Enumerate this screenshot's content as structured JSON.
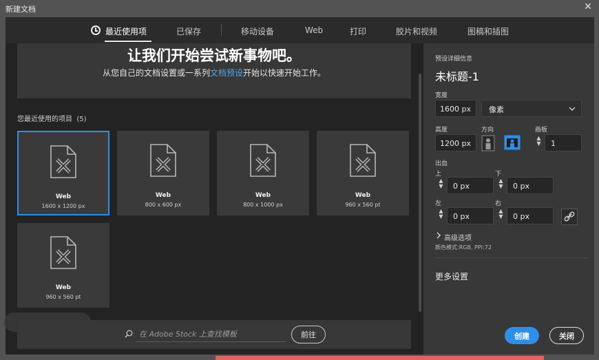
{
  "window": {
    "title": "新建文档",
    "close_symbol": "✕"
  },
  "tabs": [
    {
      "label": "最近使用项",
      "active": true
    },
    {
      "label": "已保存"
    },
    {
      "label": "移动设备"
    },
    {
      "label": "Web"
    },
    {
      "label": "打印"
    },
    {
      "label": "胶片和视频"
    },
    {
      "label": "图稿和插图"
    }
  ],
  "banner": {
    "headline": "让我们开始尝试新事物吧。",
    "sub_before": "从您自己的文档设置或一系列",
    "sub_link": "文档预设",
    "sub_after": "开始以快速开始工作。"
  },
  "recent": {
    "title": "您最近使用的项目",
    "count": "(5)",
    "items": [
      {
        "name": "Web",
        "dims": "1600 x 1200 px",
        "selected": true
      },
      {
        "name": "Web",
        "dims": "800 x 600 px"
      },
      {
        "name": "Web",
        "dims": "800 x 1000 px"
      },
      {
        "name": "Web",
        "dims": "960 x 560 pt"
      },
      {
        "name": "Web",
        "dims": "960 x 560 pt"
      }
    ]
  },
  "search": {
    "placeholder": "在 Adobe Stock 上查找模板",
    "goto_label": "前往"
  },
  "details": {
    "section_label": "预设详细信息",
    "preset_name": "未标题-1",
    "width_label": "宽度",
    "width_value": "1600 px",
    "unit": "像素",
    "height_label": "高度",
    "height_value": "1200 px",
    "orientation_label": "方向",
    "artboard_label": "画板",
    "artboard_value": "1",
    "bleed_label": "出血",
    "bleed_top_label": "上",
    "bleed_top": "0 px",
    "bleed_bottom_label": "下",
    "bleed_bottom": "0 px",
    "bleed_left_label": "左",
    "bleed_left": "0 px",
    "bleed_right_label": "右",
    "bleed_right": "0 px",
    "advanced_label": "高级选项",
    "color_mode": "颜色模式:RGB, PPI:72",
    "more_settings": "更多设置",
    "create_label": "创建",
    "close_label": "关闭"
  },
  "colors": {
    "accent": "#2f8ee8",
    "link": "#4ea6e8"
  }
}
